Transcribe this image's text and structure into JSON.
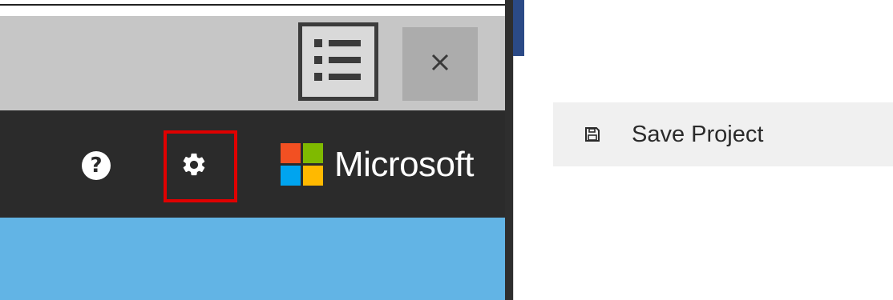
{
  "toolbar": {
    "list_view_icon": "list-view-icon",
    "close_icon": "close-icon",
    "close_glyph": "✕"
  },
  "header": {
    "help_icon": "help-icon",
    "help_glyph": "?",
    "settings_icon": "gear-icon",
    "brand_name": "Microsoft",
    "logo_colors": [
      "#f25022",
      "#7fba00",
      "#00a4ef",
      "#ffb900"
    ]
  },
  "menu": {
    "save_project": {
      "icon": "floppy-disk-icon",
      "label": "Save Project"
    }
  },
  "colors": {
    "highlight": "#e00000",
    "header_bg": "#2b2b2b",
    "content_bg": "#62b4e5",
    "toolbar_bg": "#c6c6c6",
    "menu_bg": "#f0f0f0"
  }
}
